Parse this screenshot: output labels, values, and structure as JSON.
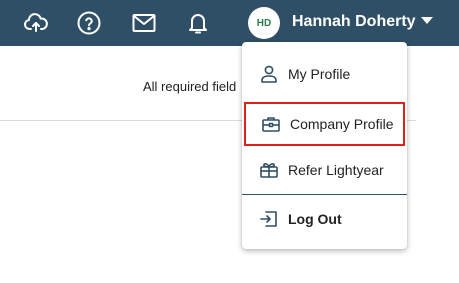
{
  "topbar": {
    "icons": [
      "cloud-upload-icon",
      "help-icon",
      "mail-icon",
      "bell-icon"
    ],
    "avatar_initials": "HD",
    "user_name": "Hannah Doherty",
    "colors": {
      "bar": "#2f4f66",
      "avatar_text": "#2e7d4f"
    }
  },
  "main": {
    "required_note": "All required field"
  },
  "menu": {
    "items": [
      {
        "label": "My Profile",
        "icon": "user-icon"
      },
      {
        "label": "Company Profile",
        "icon": "briefcase-icon",
        "highlighted": true
      },
      {
        "label": "Refer Lightyear",
        "icon": "gift-icon"
      },
      {
        "label": "Log Out",
        "icon": "logout-icon",
        "bold": true
      }
    ],
    "highlight_color": "#e0201c"
  }
}
